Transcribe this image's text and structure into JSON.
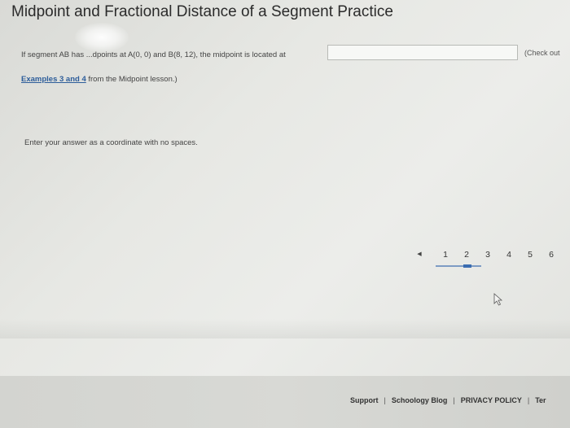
{
  "page": {
    "title": "Midpoint and Fractional Distance of a Segment Practice"
  },
  "question": {
    "text": "If segment AB has ...dpoints at A(0, 0) and B(8, 12), the midpoint is located at",
    "answer_value": "",
    "check_out_text": "(Check out",
    "examples_link": "Examples 3 and 4",
    "examples_rest": " from the Midpoint lesson.)",
    "instruction": "Enter your answer as a coordinate with no spaces."
  },
  "pagination": {
    "prev_icon": "◀",
    "pages": [
      "1",
      "2",
      "3",
      "4",
      "5",
      "6"
    ],
    "current": "2"
  },
  "footer": {
    "links": [
      "Support",
      "Schoology Blog",
      "PRIVACY POLICY",
      "Ter"
    ],
    "separator": "|"
  }
}
